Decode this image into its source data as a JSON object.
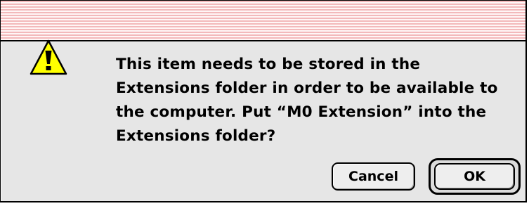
{
  "dialog": {
    "icon": "caution-icon",
    "message": "This item needs to be stored in the Extensions folder in order to be available to the computer. Put “M0 Extension” into the Extensions folder?",
    "cancel_label": "Cancel",
    "ok_label": "OK",
    "default_button": "OK",
    "colors": {
      "titlebar_stripe": "#f3b9bb",
      "titlebar_light": "#fff6f6",
      "body": "#e6e6e6",
      "caution_yellow": "#ffff00"
    }
  }
}
